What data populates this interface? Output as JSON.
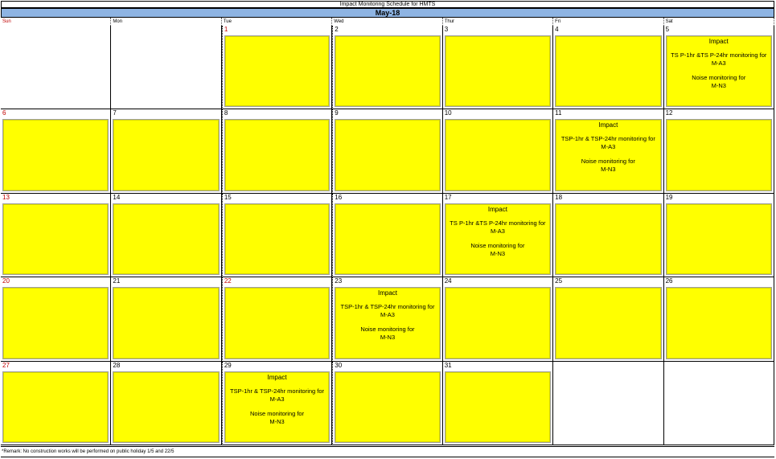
{
  "header": {
    "title": "Impact Monitoring Schedule for HMTS",
    "month": "May-18"
  },
  "weekdays": [
    "Sun",
    "Mon",
    "Tue",
    "Wed",
    "Thur",
    "Fri",
    "Sat"
  ],
  "colors": {
    "month_bar": "#8eb4e3",
    "note_fill": "#ffff00",
    "holiday_text": "#c00000"
  },
  "event_template": {
    "title": "Impact",
    "line1": "TSP-1hr & TSP-24hr monitoring for",
    "line2": "M-A3",
    "line3": "Noise monitoring for",
    "line4": "M-N3"
  },
  "weeks": [
    [
      {
        "day": "",
        "note": false
      },
      {
        "day": "",
        "note": false
      },
      {
        "day": "1",
        "red": true,
        "note": true
      },
      {
        "day": "2",
        "note": true
      },
      {
        "day": "3",
        "note": true
      },
      {
        "day": "4",
        "note": true
      },
      {
        "day": "5",
        "note": true,
        "event": {
          "title": "Impact",
          "line1": "TS P-1hr &TS P-24hr monitoring for",
          "line2": "M-A3",
          "line3": "Noise monitoring for",
          "line4": "M-N3"
        }
      }
    ],
    [
      {
        "day": "6",
        "red": true,
        "note": true
      },
      {
        "day": "7",
        "note": true
      },
      {
        "day": "8",
        "note": true
      },
      {
        "day": "9",
        "note": true
      },
      {
        "day": "10",
        "note": true
      },
      {
        "day": "11",
        "note": true,
        "event": {
          "title": "Impact",
          "line1": "TSP-1hr & TSP-24hr monitoring for",
          "line2": "M-A3",
          "line3": "Noise monitoring for",
          "line4": "M-N3"
        }
      },
      {
        "day": "12",
        "note": true
      }
    ],
    [
      {
        "day": "13",
        "red": true,
        "note": true
      },
      {
        "day": "14",
        "note": true
      },
      {
        "day": "15",
        "note": true
      },
      {
        "day": "16",
        "note": true
      },
      {
        "day": "17",
        "note": true,
        "event": {
          "title": "Impact",
          "line1": "TS P-1hr &TS P-24hr monitoring for",
          "line2": "M-A3",
          "line3": "Noise monitoring for",
          "line4": "M-N3"
        }
      },
      {
        "day": "18",
        "note": true
      },
      {
        "day": "19",
        "note": true
      }
    ],
    [
      {
        "day": "20",
        "red": true,
        "note": true
      },
      {
        "day": "21",
        "note": true
      },
      {
        "day": "22",
        "red": true,
        "note": true
      },
      {
        "day": "23",
        "note": true,
        "event": {
          "title": "Impact",
          "line1": "TSP-1hr & TSP-24hr monitoring for",
          "line2": "M-A3",
          "line3": "Noise monitoring for",
          "line4": "M-N3"
        }
      },
      {
        "day": "24",
        "note": true
      },
      {
        "day": "25",
        "note": true
      },
      {
        "day": "26",
        "note": true
      }
    ],
    [
      {
        "day": "27",
        "red": true,
        "note": true
      },
      {
        "day": "28",
        "note": true
      },
      {
        "day": "29",
        "note": true,
        "event": {
          "title": "Impact",
          "line1": "TSP-1hr & TSP-24hr monitoring for",
          "line2": "M-A3",
          "line3": "Noise monitoring for",
          "line4": "M-N3"
        }
      },
      {
        "day": "30",
        "note": true
      },
      {
        "day": "31",
        "note": true
      },
      {
        "day": "",
        "note": false
      },
      {
        "day": "",
        "note": false
      }
    ]
  ],
  "remark": "*Remark: No construction works will be performed on public holiday 1/5 and 22/5"
}
